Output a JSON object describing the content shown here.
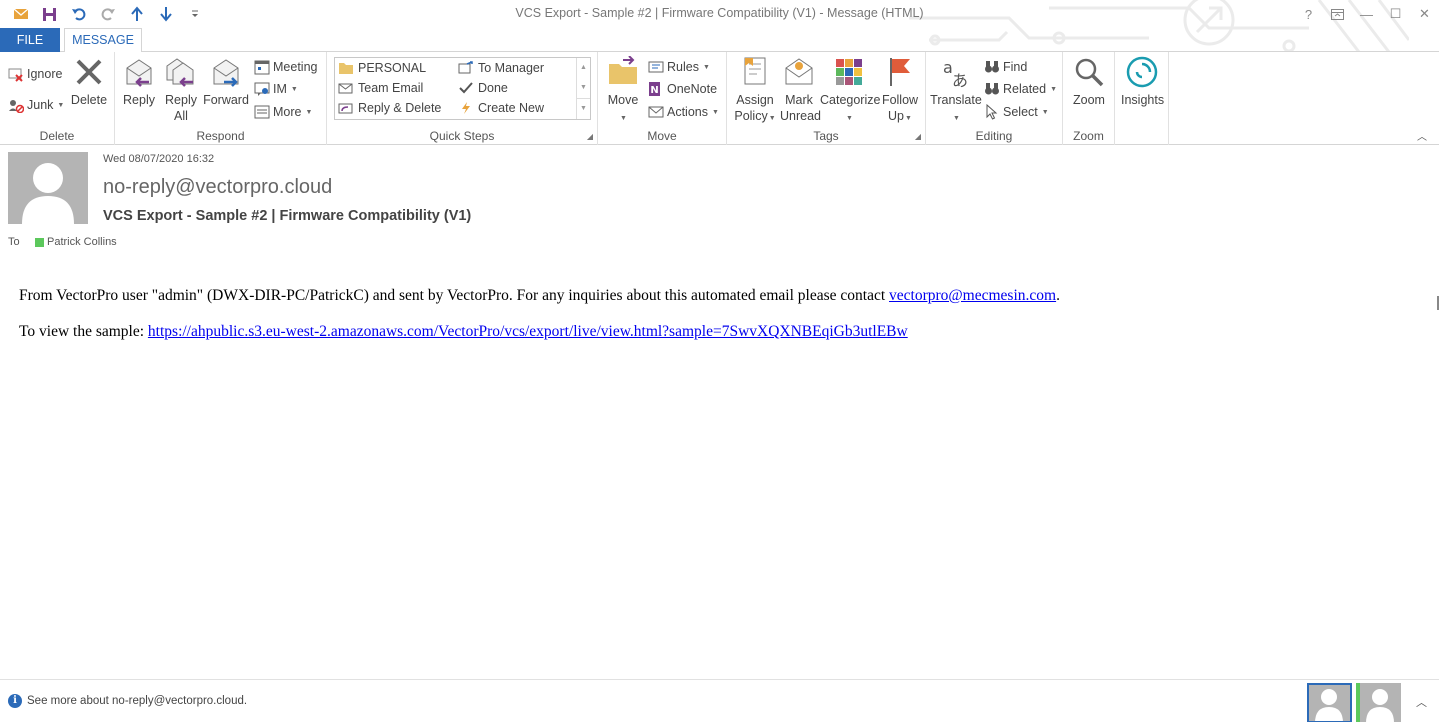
{
  "window": {
    "title": "VCS Export - Sample #2 | Firmware Compatibility (V1) - Message (HTML)",
    "help": "?",
    "min": "—",
    "max": "☐",
    "close": "✕"
  },
  "tabs": {
    "file": "FILE",
    "message": "MESSAGE"
  },
  "ribbon": {
    "delete_group": {
      "label": "Delete",
      "ignore": "Ignore",
      "junk": "Junk",
      "delete": "Delete"
    },
    "respond_group": {
      "label": "Respond",
      "reply": "Reply",
      "reply_all_1": "Reply",
      "reply_all_2": "All",
      "forward": "Forward",
      "meeting": "Meeting",
      "im": "IM",
      "more": "More"
    },
    "quicksteps_group": {
      "label": "Quick Steps",
      "items": [
        "PERSONAL",
        "To Manager",
        "Team Email",
        "Done",
        "Reply & Delete",
        "Create New"
      ]
    },
    "move_group": {
      "label": "Move",
      "move": "Move",
      "rules": "Rules",
      "onenote": "OneNote",
      "actions": "Actions"
    },
    "tags_group": {
      "label": "Tags",
      "assign_1": "Assign",
      "assign_2": "Policy",
      "mark_1": "Mark",
      "mark_2": "Unread",
      "categorize": "Categorize",
      "follow_1": "Follow",
      "follow_2": "Up"
    },
    "editing_group": {
      "label": "Editing",
      "translate": "Translate",
      "find": "Find",
      "related": "Related",
      "select": "Select"
    },
    "zoom_group": {
      "label": "Zoom",
      "zoom": "Zoom"
    },
    "insights": {
      "label": "Insights"
    }
  },
  "message": {
    "date": "Wed 08/07/2020 16:32",
    "sender": "no-reply@vectorpro.cloud",
    "subject": "VCS Export - Sample #2 | Firmware Compatibility (V1)",
    "to_label": "To",
    "recipient": "Patrick Collins",
    "body_line1_prefix": "From VectorPro user \"admin\" (DWX-DIR-PC/PatrickC) and sent by VectorPro. For any inquiries about this automated email please contact ",
    "contact_email": "vectorpro@mecmesin.com",
    "body_line1_suffix": ".",
    "body_line2_prefix": "To view the sample: ",
    "sample_link": "https://ahpublic.s3.eu-west-2.amazonaws.com/VectorPro/vcs/export/live/view.html?sample=7SwvXQXNBEqiGb3utlEBw"
  },
  "footer": {
    "see_more": "See more about no-reply@vectorpro.cloud."
  },
  "colors": {
    "accent": "#2b6ab8",
    "presence": "#5cc85c",
    "link": "#0000ee"
  }
}
